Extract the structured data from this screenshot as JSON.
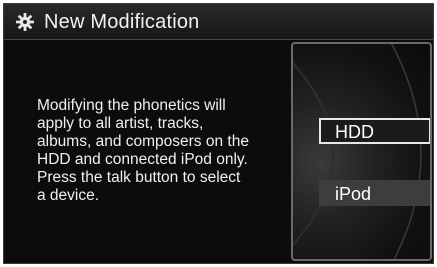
{
  "header": {
    "title": "New Modification",
    "icon": "gear-icon"
  },
  "message": {
    "text": "Modifying the phonetics will\napply to all artist, tracks,\nalbums, and composers on the\nHDD and connected iPod only.\nPress the talk button to select\na device."
  },
  "options": [
    {
      "label": "HDD",
      "selected": true
    },
    {
      "label": "iPod",
      "selected": false
    }
  ],
  "colors": {
    "background": "#0c0c0c",
    "text": "#f0f0f0",
    "selection_border": "#e8e8e8",
    "option_bar": "#3d3d3d"
  }
}
